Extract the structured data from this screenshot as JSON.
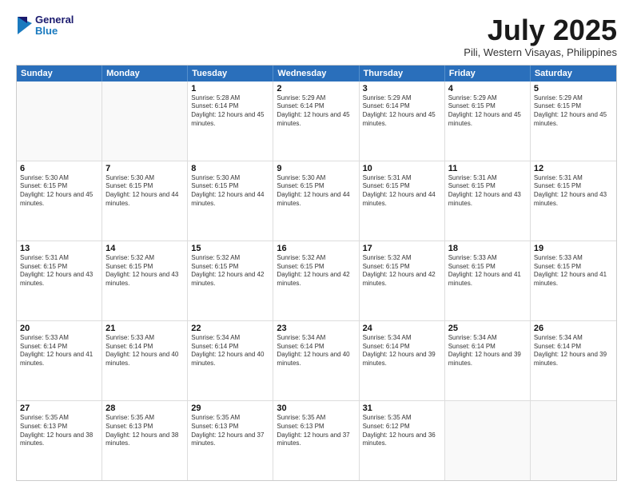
{
  "logo": {
    "general": "General",
    "blue": "Blue"
  },
  "title": "July 2025",
  "subtitle": "Pili, Western Visayas, Philippines",
  "days": [
    "Sunday",
    "Monday",
    "Tuesday",
    "Wednesday",
    "Thursday",
    "Friday",
    "Saturday"
  ],
  "weeks": [
    [
      {
        "day": "",
        "empty": true
      },
      {
        "day": "",
        "empty": true
      },
      {
        "day": "1",
        "sunrise": "5:28 AM",
        "sunset": "6:14 PM",
        "daylight": "12 hours and 45 minutes."
      },
      {
        "day": "2",
        "sunrise": "5:29 AM",
        "sunset": "6:14 PM",
        "daylight": "12 hours and 45 minutes."
      },
      {
        "day": "3",
        "sunrise": "5:29 AM",
        "sunset": "6:14 PM",
        "daylight": "12 hours and 45 minutes."
      },
      {
        "day": "4",
        "sunrise": "5:29 AM",
        "sunset": "6:15 PM",
        "daylight": "12 hours and 45 minutes."
      },
      {
        "day": "5",
        "sunrise": "5:29 AM",
        "sunset": "6:15 PM",
        "daylight": "12 hours and 45 minutes."
      }
    ],
    [
      {
        "day": "6",
        "sunrise": "5:30 AM",
        "sunset": "6:15 PM",
        "daylight": "12 hours and 45 minutes."
      },
      {
        "day": "7",
        "sunrise": "5:30 AM",
        "sunset": "6:15 PM",
        "daylight": "12 hours and 44 minutes."
      },
      {
        "day": "8",
        "sunrise": "5:30 AM",
        "sunset": "6:15 PM",
        "daylight": "12 hours and 44 minutes."
      },
      {
        "day": "9",
        "sunrise": "5:30 AM",
        "sunset": "6:15 PM",
        "daylight": "12 hours and 44 minutes."
      },
      {
        "day": "10",
        "sunrise": "5:31 AM",
        "sunset": "6:15 PM",
        "daylight": "12 hours and 44 minutes."
      },
      {
        "day": "11",
        "sunrise": "5:31 AM",
        "sunset": "6:15 PM",
        "daylight": "12 hours and 43 minutes."
      },
      {
        "day": "12",
        "sunrise": "5:31 AM",
        "sunset": "6:15 PM",
        "daylight": "12 hours and 43 minutes."
      }
    ],
    [
      {
        "day": "13",
        "sunrise": "5:31 AM",
        "sunset": "6:15 PM",
        "daylight": "12 hours and 43 minutes."
      },
      {
        "day": "14",
        "sunrise": "5:32 AM",
        "sunset": "6:15 PM",
        "daylight": "12 hours and 43 minutes."
      },
      {
        "day": "15",
        "sunrise": "5:32 AM",
        "sunset": "6:15 PM",
        "daylight": "12 hours and 42 minutes."
      },
      {
        "day": "16",
        "sunrise": "5:32 AM",
        "sunset": "6:15 PM",
        "daylight": "12 hours and 42 minutes."
      },
      {
        "day": "17",
        "sunrise": "5:32 AM",
        "sunset": "6:15 PM",
        "daylight": "12 hours and 42 minutes."
      },
      {
        "day": "18",
        "sunrise": "5:33 AM",
        "sunset": "6:15 PM",
        "daylight": "12 hours and 41 minutes."
      },
      {
        "day": "19",
        "sunrise": "5:33 AM",
        "sunset": "6:15 PM",
        "daylight": "12 hours and 41 minutes."
      }
    ],
    [
      {
        "day": "20",
        "sunrise": "5:33 AM",
        "sunset": "6:14 PM",
        "daylight": "12 hours and 41 minutes."
      },
      {
        "day": "21",
        "sunrise": "5:33 AM",
        "sunset": "6:14 PM",
        "daylight": "12 hours and 40 minutes."
      },
      {
        "day": "22",
        "sunrise": "5:34 AM",
        "sunset": "6:14 PM",
        "daylight": "12 hours and 40 minutes."
      },
      {
        "day": "23",
        "sunrise": "5:34 AM",
        "sunset": "6:14 PM",
        "daylight": "12 hours and 40 minutes."
      },
      {
        "day": "24",
        "sunrise": "5:34 AM",
        "sunset": "6:14 PM",
        "daylight": "12 hours and 39 minutes."
      },
      {
        "day": "25",
        "sunrise": "5:34 AM",
        "sunset": "6:14 PM",
        "daylight": "12 hours and 39 minutes."
      },
      {
        "day": "26",
        "sunrise": "5:34 AM",
        "sunset": "6:14 PM",
        "daylight": "12 hours and 39 minutes."
      }
    ],
    [
      {
        "day": "27",
        "sunrise": "5:35 AM",
        "sunset": "6:13 PM",
        "daylight": "12 hours and 38 minutes."
      },
      {
        "day": "28",
        "sunrise": "5:35 AM",
        "sunset": "6:13 PM",
        "daylight": "12 hours and 38 minutes."
      },
      {
        "day": "29",
        "sunrise": "5:35 AM",
        "sunset": "6:13 PM",
        "daylight": "12 hours and 37 minutes."
      },
      {
        "day": "30",
        "sunrise": "5:35 AM",
        "sunset": "6:13 PM",
        "daylight": "12 hours and 37 minutes."
      },
      {
        "day": "31",
        "sunrise": "5:35 AM",
        "sunset": "6:12 PM",
        "daylight": "12 hours and 36 minutes."
      },
      {
        "day": "",
        "empty": true
      },
      {
        "day": "",
        "empty": true
      }
    ]
  ]
}
